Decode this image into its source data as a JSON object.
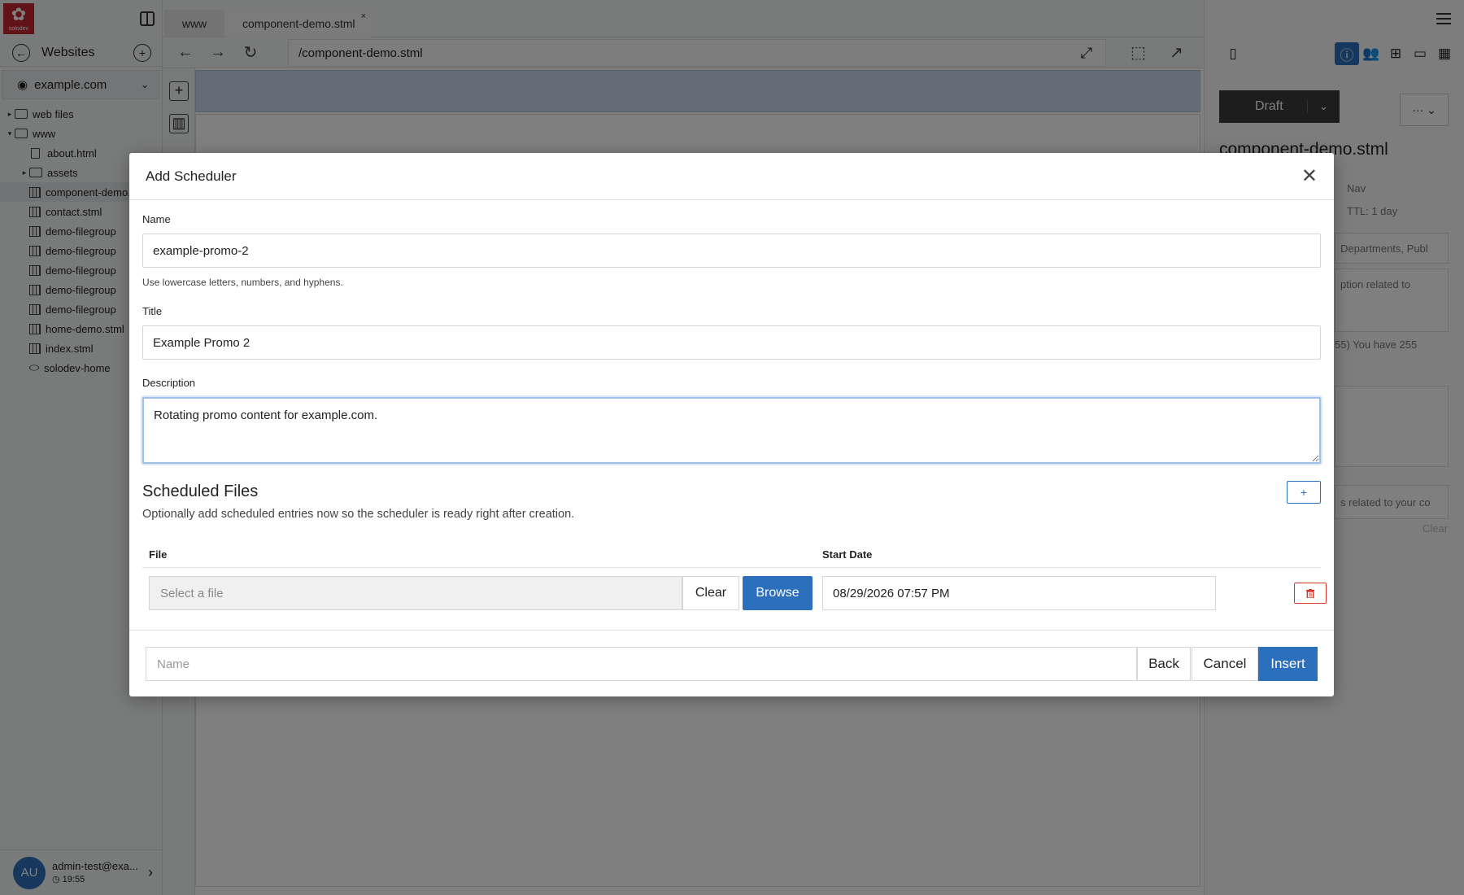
{
  "sidebar": {
    "logo_text": "solodev",
    "websites_label": "Websites",
    "domain": "example.com",
    "tree": [
      {
        "label": "web files",
        "type": "folder",
        "caret": "▸",
        "indent": 0
      },
      {
        "label": "www",
        "type": "folder",
        "caret": "▾",
        "indent": 0
      },
      {
        "label": "about.html",
        "type": "file",
        "caret": "",
        "indent": 1
      },
      {
        "label": "assets",
        "type": "folder",
        "caret": "▸",
        "indent": 1
      },
      {
        "label": "component-demo.stml",
        "type": "grid",
        "caret": "",
        "indent": 1
      },
      {
        "label": "contact.stml",
        "type": "grid",
        "caret": "",
        "indent": 1
      },
      {
        "label": "demo-filegroup",
        "type": "grid",
        "caret": "",
        "indent": 1
      },
      {
        "label": "demo-filegroup",
        "type": "grid",
        "caret": "",
        "indent": 1
      },
      {
        "label": "demo-filegroup",
        "type": "grid",
        "caret": "",
        "indent": 1
      },
      {
        "label": "demo-filegroup",
        "type": "grid",
        "caret": "",
        "indent": 1
      },
      {
        "label": "demo-filegroup",
        "type": "grid",
        "caret": "",
        "indent": 1
      },
      {
        "label": "home-demo.stml",
        "type": "grid",
        "caret": "",
        "indent": 1
      },
      {
        "label": "index.stml",
        "type": "grid",
        "caret": "",
        "indent": 1
      },
      {
        "label": "solodev-home",
        "type": "link",
        "caret": "",
        "indent": 1
      }
    ],
    "user": {
      "initials": "AU",
      "email": "admin-test@exa...",
      "time": "19:55"
    }
  },
  "tabs": [
    {
      "label": "www"
    },
    {
      "label": "component-demo.stml",
      "close": "×"
    }
  ],
  "urlbar": {
    "url": "/component-demo.stml"
  },
  "right_panel": {
    "status": "Draft",
    "title": "component-demo.stml",
    "nav_label": "Nav",
    "ttl_label": "TTL: 1 day",
    "categories_placeholder": "Departments, Publ",
    "desc_fragment": "ption related to",
    "counter": "55) You have 255",
    "keywords_fragment": "s related to your co",
    "clear_label": "Clear"
  },
  "modal": {
    "title": "Add Scheduler",
    "name_label": "Name",
    "name_value": "example-promo-2",
    "name_help": "Use lowercase letters, numbers, and hyphens.",
    "title_label": "Title",
    "title_value": "Example Promo 2",
    "description_label": "Description",
    "description_value": "Rotating promo content for example.com.",
    "scheduled_title": "Scheduled Files",
    "scheduled_desc": "Optionally add scheduled entries now so the scheduler is ready right after creation.",
    "add_label": "+",
    "col_file": "File",
    "col_start": "Start Date",
    "row": {
      "file_placeholder": "Select a file",
      "clear": "Clear",
      "browse": "Browse",
      "start_date": "08/29/2026 07:57 PM"
    },
    "footer": {
      "name_placeholder": "Name",
      "back": "Back",
      "cancel": "Cancel",
      "insert": "Insert"
    }
  },
  "colors": {
    "accent": "#2c6fbd",
    "danger": "#d9362b",
    "brand": "#c4262e"
  }
}
